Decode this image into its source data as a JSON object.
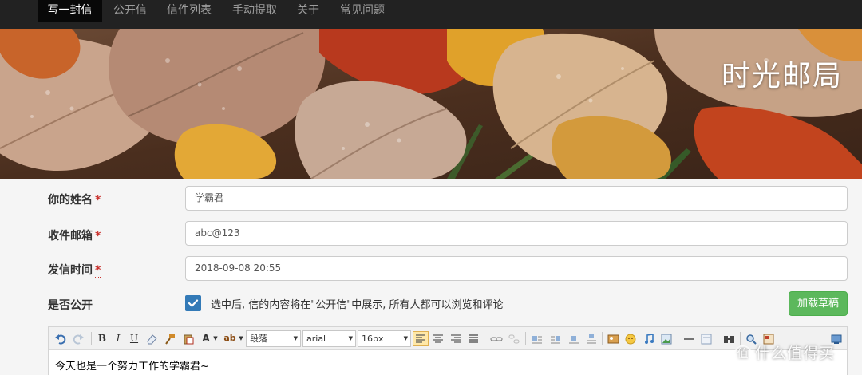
{
  "nav": {
    "items": [
      {
        "label": "写一封信",
        "active": true
      },
      {
        "label": "公开信",
        "active": false
      },
      {
        "label": "信件列表",
        "active": false
      },
      {
        "label": "手动提取",
        "active": false
      },
      {
        "label": "关于",
        "active": false
      },
      {
        "label": "常见问题",
        "active": false
      }
    ]
  },
  "banner": {
    "title": "时光邮局",
    "image": "autumn maple leaves with water droplets"
  },
  "form": {
    "name_label": "你的姓名",
    "name_value": "学霸君",
    "email_label": "收件邮箱",
    "email_value": "abc@123",
    "time_label": "发信时间",
    "time_value": "2018-09-08 20:55",
    "public_label": "是否公开",
    "required_mark": "*",
    "public_checked": true,
    "public_description": "选中后, 信的内容将在\"公开信\"中展示, 所有人都可以浏览和评论",
    "draft_button": "加载草稿"
  },
  "editor": {
    "paragraph_select": "段落",
    "font_select": "arial",
    "size_select": "16px",
    "font_color_label": "A",
    "highlight_label": "ab",
    "bold_label": "B",
    "italic_label": "I",
    "underline_label": "U",
    "content": "今天也是一个努力工作的学霸君~"
  },
  "watermark": {
    "symbol": "值",
    "text": "什么值得买"
  },
  "colors": {
    "navbar": "#222222",
    "active_nav": "#080808",
    "primary": "#337ab7",
    "success": "#5cb85c",
    "required": "#c9302c"
  }
}
